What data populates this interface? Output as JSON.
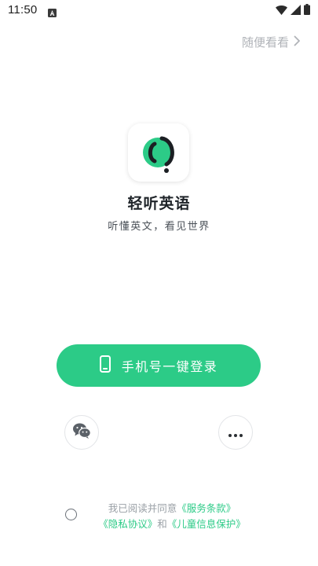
{
  "status_bar": {
    "time": "11:50"
  },
  "header": {
    "skip_label": "随便看看"
  },
  "app": {
    "name": "轻听英语",
    "tagline": "听懂英文，看见世界"
  },
  "login": {
    "phone_label": "手机号一键登录"
  },
  "agreement": {
    "prefix": "我已阅读并同意",
    "terms_link": "《服务条款》",
    "privacy_link": "《隐私协议》",
    "and": "和",
    "child_link": "《儿童信息保护》"
  },
  "colors": {
    "accent": "#2ccb87",
    "text_dark": "#1f2429",
    "muted": "#b0b3b8"
  }
}
